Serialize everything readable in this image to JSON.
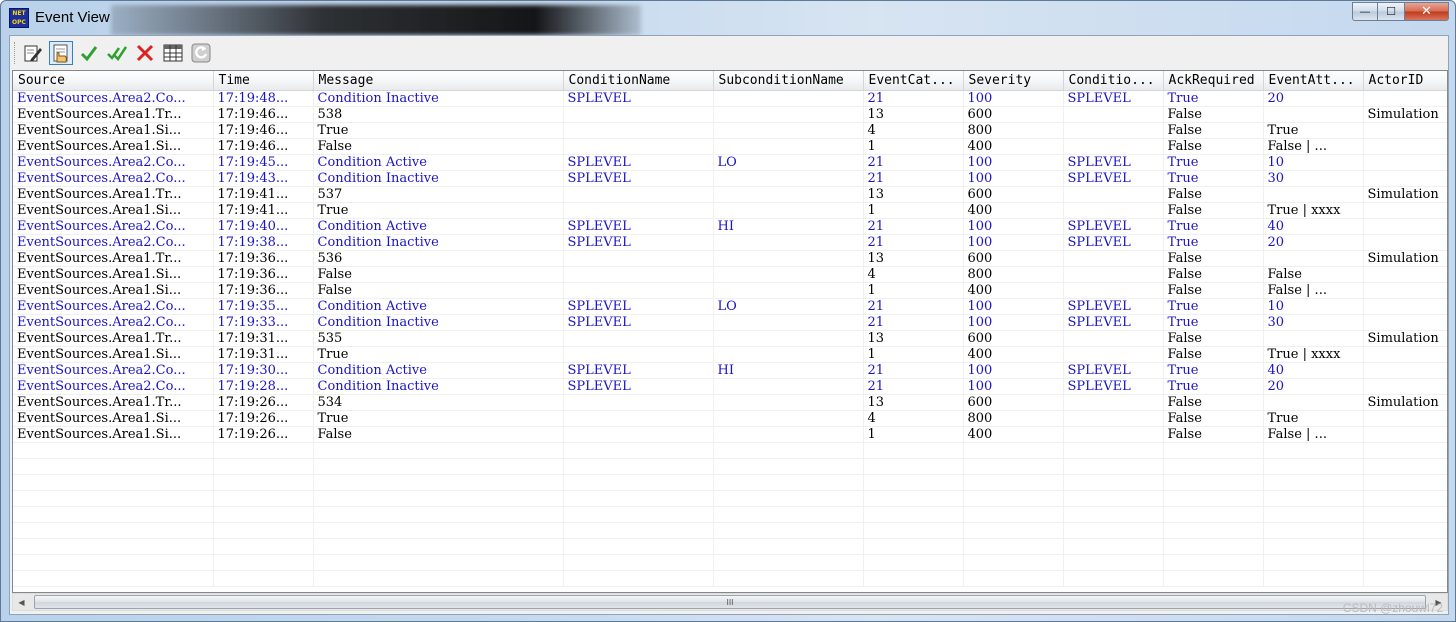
{
  "window": {
    "title": "Event View",
    "app_icon_text_top": "NET",
    "app_icon_text_bottom": "OPC",
    "caption_buttons": {
      "minimize": "—",
      "maximize": "☐",
      "close": "✕"
    }
  },
  "toolbar": {
    "buttons": [
      {
        "name": "edit-icon"
      },
      {
        "name": "hand-select-icon",
        "active": true
      },
      {
        "name": "check-icon"
      },
      {
        "name": "double-check-icon"
      },
      {
        "name": "delete-x-icon"
      },
      {
        "name": "table-icon"
      },
      {
        "name": "refresh-icon"
      }
    ]
  },
  "grid": {
    "columns": [
      "Source",
      "Time",
      "Message",
      "ConditionName",
      "SubconditionName",
      "EventCat...",
      "Severity",
      "Conditio...",
      "AckRequired",
      "EventAtt...",
      "ActorID"
    ],
    "rows": [
      [
        "EventSources.Area2.Co...",
        "17:19:48...",
        "Condition Inactive",
        "SPLEVEL",
        "",
        "21",
        "100",
        "SPLEVEL",
        "True",
        "20",
        ""
      ],
      [
        "EventSources.Area1.Tr...",
        "17:19:46...",
        "538",
        "",
        "",
        "13",
        "600",
        "",
        "False",
        "",
        "Simulation"
      ],
      [
        "EventSources.Area1.Si...",
        "17:19:46...",
        "True",
        "",
        "",
        "4",
        "800",
        "",
        "False",
        "True",
        ""
      ],
      [
        "EventSources.Area1.Si...",
        "17:19:46...",
        "False",
        "",
        "",
        "1",
        "400",
        "",
        "False",
        "False | ...",
        ""
      ],
      [
        "EventSources.Area2.Co...",
        "17:19:45...",
        "Condition Active",
        "SPLEVEL",
        "LO",
        "21",
        "100",
        "SPLEVEL",
        "True",
        "10",
        ""
      ],
      [
        "EventSources.Area2.Co...",
        "17:19:43...",
        "Condition Inactive",
        "SPLEVEL",
        "",
        "21",
        "100",
        "SPLEVEL",
        "True",
        "30",
        ""
      ],
      [
        "EventSources.Area1.Tr...",
        "17:19:41...",
        "537",
        "",
        "",
        "13",
        "600",
        "",
        "False",
        "",
        "Simulation"
      ],
      [
        "EventSources.Area1.Si...",
        "17:19:41...",
        "True",
        "",
        "",
        "1",
        "400",
        "",
        "False",
        "True | xxxx",
        ""
      ],
      [
        "EventSources.Area2.Co...",
        "17:19:40...",
        "Condition Active",
        "SPLEVEL",
        "HI",
        "21",
        "100",
        "SPLEVEL",
        "True",
        "40",
        ""
      ],
      [
        "EventSources.Area2.Co...",
        "17:19:38...",
        "Condition Inactive",
        "SPLEVEL",
        "",
        "21",
        "100",
        "SPLEVEL",
        "True",
        "20",
        ""
      ],
      [
        "EventSources.Area1.Tr...",
        "17:19:36...",
        "536",
        "",
        "",
        "13",
        "600",
        "",
        "False",
        "",
        "Simulation"
      ],
      [
        "EventSources.Area1.Si...",
        "17:19:36...",
        "False",
        "",
        "",
        "4",
        "800",
        "",
        "False",
        "False",
        ""
      ],
      [
        "EventSources.Area1.Si...",
        "17:19:36...",
        "False",
        "",
        "",
        "1",
        "400",
        "",
        "False",
        "False | ...",
        ""
      ],
      [
        "EventSources.Area2.Co...",
        "17:19:35...",
        "Condition Active",
        "SPLEVEL",
        "LO",
        "21",
        "100",
        "SPLEVEL",
        "True",
        "10",
        ""
      ],
      [
        "EventSources.Area2.Co...",
        "17:19:33...",
        "Condition Inactive",
        "SPLEVEL",
        "",
        "21",
        "100",
        "SPLEVEL",
        "True",
        "30",
        ""
      ],
      [
        "EventSources.Area1.Tr...",
        "17:19:31...",
        "535",
        "",
        "",
        "13",
        "600",
        "",
        "False",
        "",
        "Simulation"
      ],
      [
        "EventSources.Area1.Si...",
        "17:19:31...",
        "True",
        "",
        "",
        "1",
        "400",
        "",
        "False",
        "True | xxxx",
        ""
      ],
      [
        "EventSources.Area2.Co...",
        "17:19:30...",
        "Condition Active",
        "SPLEVEL",
        "HI",
        "21",
        "100",
        "SPLEVEL",
        "True",
        "40",
        ""
      ],
      [
        "EventSources.Area2.Co...",
        "17:19:28...",
        "Condition Inactive",
        "SPLEVEL",
        "",
        "21",
        "100",
        "SPLEVEL",
        "True",
        "20",
        ""
      ],
      [
        "EventSources.Area1.Tr...",
        "17:19:26...",
        "534",
        "",
        "",
        "13",
        "600",
        "",
        "False",
        "",
        "Simulation"
      ],
      [
        "EventSources.Area1.Si...",
        "17:19:26...",
        "True",
        "",
        "",
        "4",
        "800",
        "",
        "False",
        "True",
        ""
      ],
      [
        "EventSources.Area1.Si...",
        "17:19:26...",
        "False",
        "",
        "",
        "1",
        "400",
        "",
        "False",
        "False | ...",
        ""
      ]
    ],
    "empty_rows": 9
  },
  "scrollbar": {
    "thumb_grip": "III"
  },
  "watermark": "CSDN @zhouwl72",
  "colors": {
    "condition_row": "#1a14c8",
    "normal_row": "#000000"
  }
}
